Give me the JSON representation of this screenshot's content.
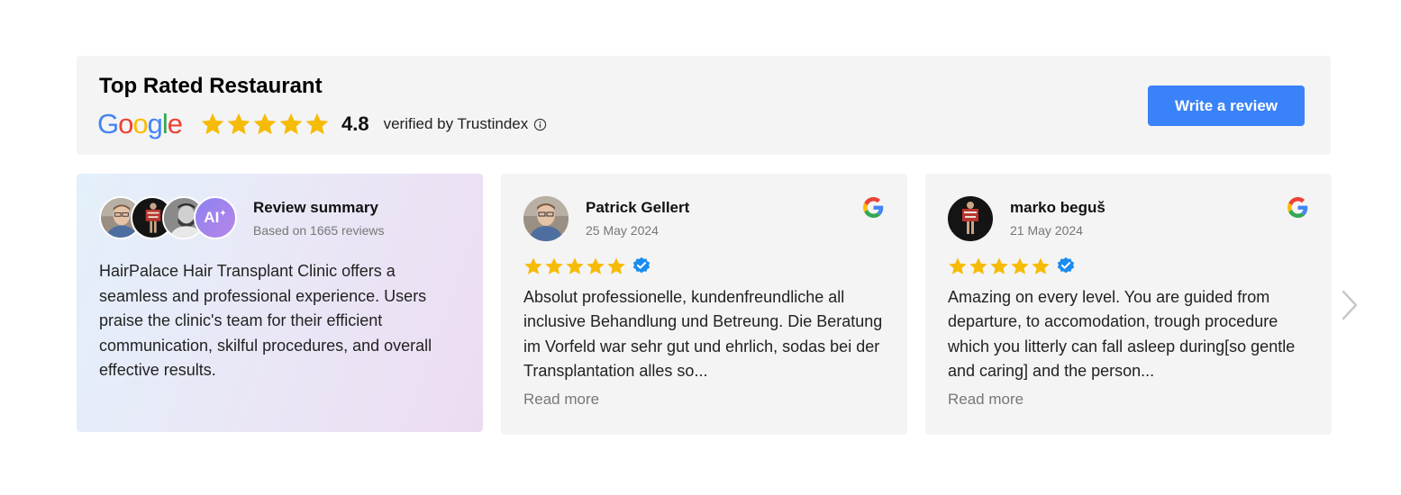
{
  "header": {
    "title": "Top Rated Restaurant",
    "rating": "4.8",
    "verified_text": "verified by Trustindex",
    "write_review_label": "Write a review",
    "google_logo_text": "Google",
    "star_color": "#f6bb06",
    "button_color": "#3a82f7"
  },
  "summary": {
    "title": "Review summary",
    "subtitle": "Based on 1665 reviews",
    "ai_badge": "AI",
    "text": "HairPalace Hair Transplant Clinic offers a seamless and professional experience. Users praise the clinic's team for their efficient communication, skilful procedures, and overall effective results."
  },
  "reviews": [
    {
      "name": "Patrick Gellert",
      "date": "25 May 2024",
      "stars": 5,
      "verified": true,
      "text": "Absolut professionelle, kundenfreundliche all inclusive Behandlung und Betreung. Die Beratung im Vorfeld war sehr gut und ehrlich, sodas bei der Transplantation alles so...",
      "read_more": "Read more"
    },
    {
      "name": "marko beguš",
      "date": "21 May 2024",
      "stars": 5,
      "verified": true,
      "text": "Amazing on every level. You are guided from departure, to accomodation, trough procedure which you litterly can fall asleep during[so gentle and caring] and the person...",
      "read_more": "Read more"
    }
  ],
  "icons": {
    "next": "chevron-right-icon",
    "info": "info-icon",
    "verified": "verified-badge-icon",
    "google": "google-g-icon"
  }
}
